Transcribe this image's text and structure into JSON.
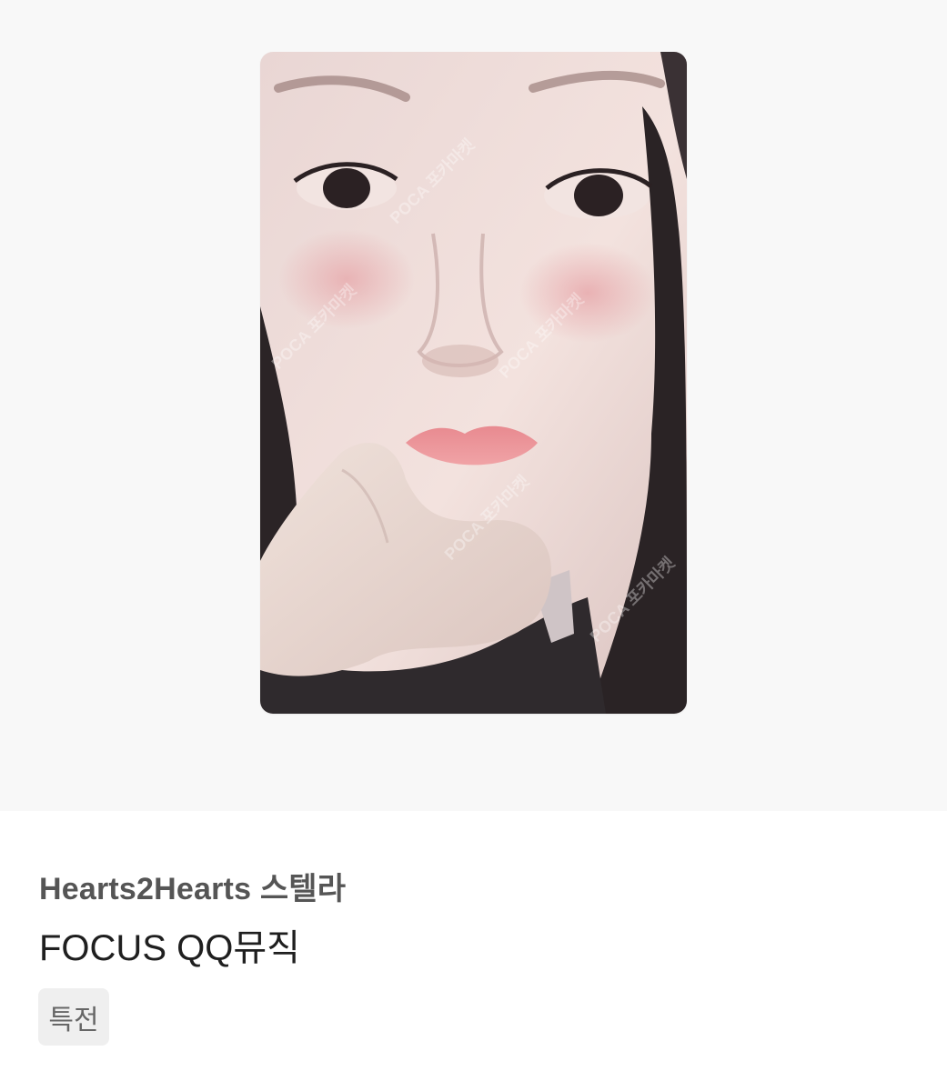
{
  "product": {
    "image_alt": "Photocard selfie",
    "watermark": "POCA 포카마켓",
    "subtitle": "Hearts2Hearts 스텔라",
    "title": "FOCUS QQ뮤직",
    "tag": "특전"
  },
  "colors": {
    "hero_background": "#f8f8f8",
    "page_background": "#ffffff",
    "subtitle_text": "#555555",
    "title_text": "#1f1f1f",
    "tag_background": "#efefef",
    "tag_text": "#666666"
  }
}
